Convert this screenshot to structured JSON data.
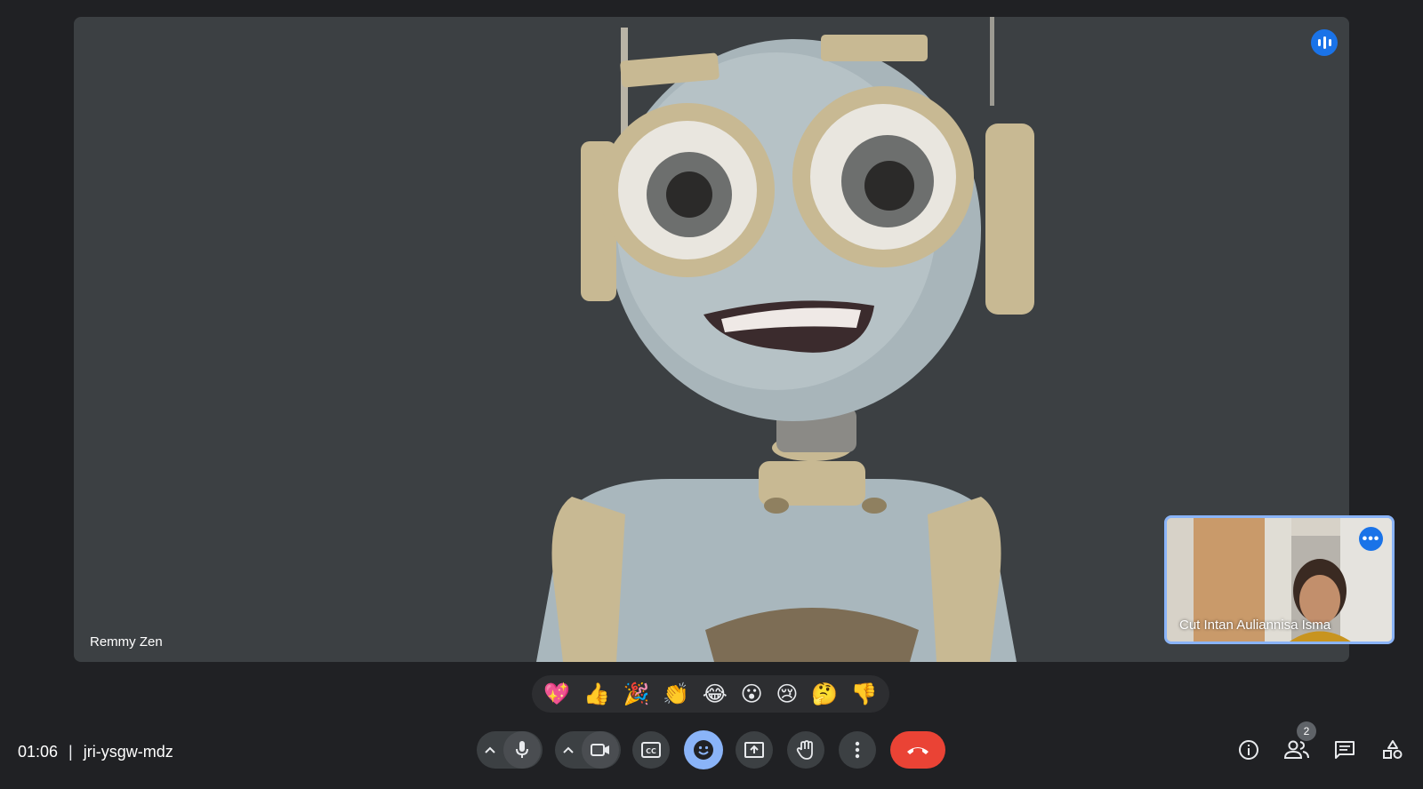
{
  "stage": {
    "main_participant": "Remmy Zen",
    "self_participant": "Cut Intan Auliannisa Isma",
    "self_more_label": "•••"
  },
  "reactions": [
    "💖",
    "👍",
    "🎉",
    "👏",
    "😂",
    "😮",
    "😢",
    "🤔",
    "👎"
  ],
  "meeting": {
    "time": "01:06",
    "separator": "|",
    "code": "jri-ysgw-mdz"
  },
  "participants_count": "2",
  "colors": {
    "background": "#202124",
    "stage": "#3c4043",
    "accent": "#1a73e8",
    "active_button": "#8ab4f8",
    "end_call": "#ea4335"
  },
  "icons": {
    "speaking": "speaking-indicator-icon",
    "mic": "microphone-icon",
    "camera": "camera-icon",
    "captions": "closed-captions-icon",
    "emoji": "emoji-icon",
    "present": "present-screen-icon",
    "hand": "raise-hand-icon",
    "more": "more-vert-icon",
    "end": "end-call-icon",
    "info": "info-icon",
    "people": "people-icon",
    "chat": "chat-icon",
    "activities": "activities-icon"
  }
}
